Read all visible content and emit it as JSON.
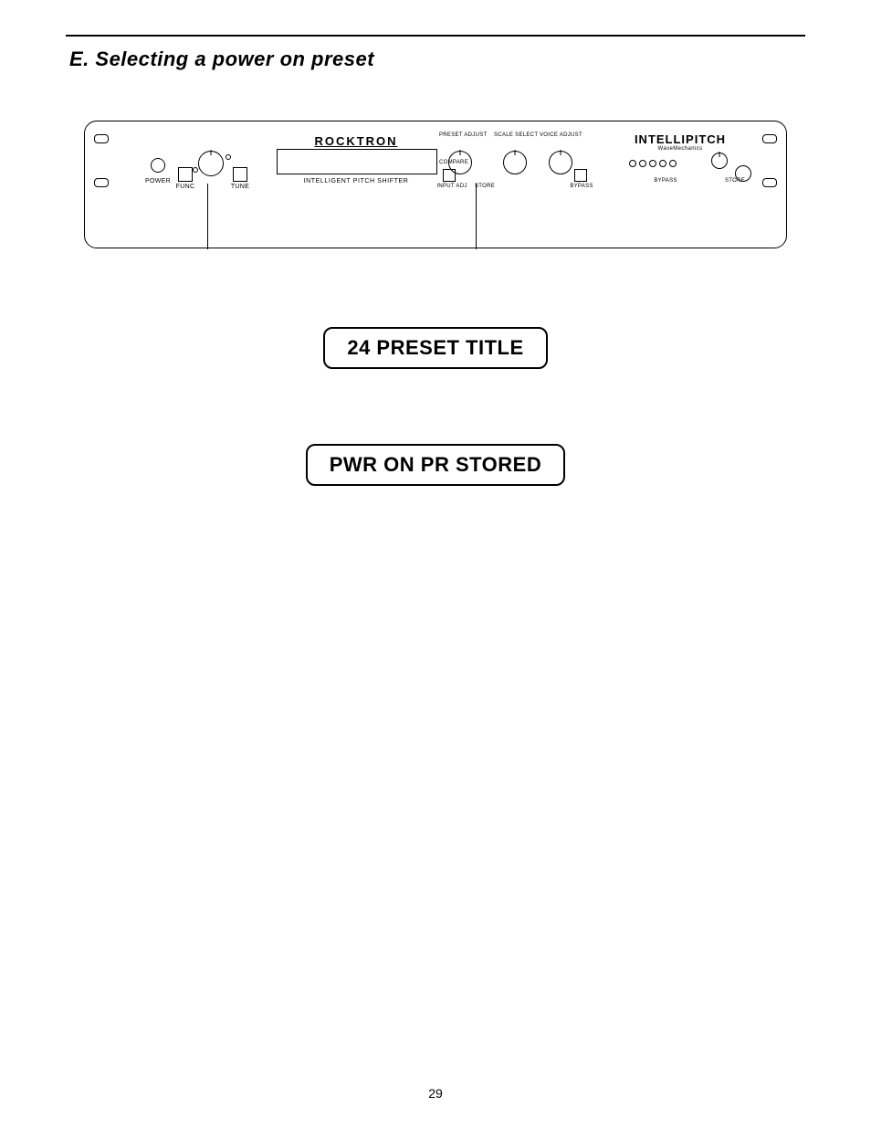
{
  "page": {
    "section_heading": "E. Selecting a power on preset",
    "page_number": "29"
  },
  "panel": {
    "brand_logo": "ROCKTRON",
    "brand_sub": "",
    "lcd_caption": "INTELLIGENT PITCH SHIFTER",
    "labels": {
      "power": "POWER",
      "func": "FUNC",
      "tune": "TUNE",
      "preset_adj": "PRESET ADJUST",
      "scale_sel": "SCALE SELECT",
      "voice_adj": "VOICE ADJUST",
      "compare": "COMPARE",
      "store": "STORE",
      "input_adj": "INPUT ADJ",
      "bypass": "BYPASS",
      "bypass2": "BYPASS",
      "store2": "STORE"
    },
    "right_logo": "INTELLIPITCH",
    "right_sub": "WaveMechanics"
  },
  "displays": {
    "preset_title": "24  PRESET TITLE",
    "pwr_stored": "PWR ON PR STORED"
  }
}
